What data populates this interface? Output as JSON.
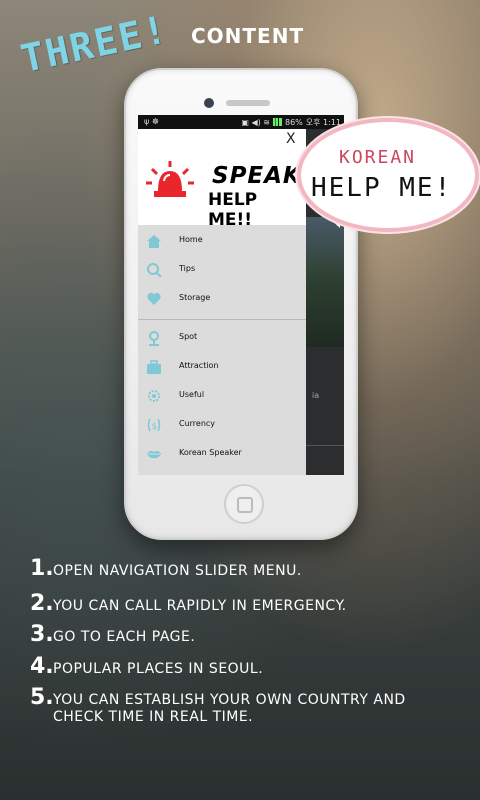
{
  "header": {
    "three": "THREE!",
    "content": "CONTENT"
  },
  "phone": {
    "statusbar": {
      "battery": "86%",
      "time": "오후 1:11"
    },
    "drawer": {
      "close": "X",
      "logo": {
        "speak": "SPEAK",
        "help": "HELP ME!!"
      },
      "items": [
        {
          "label": "Home",
          "icon": "home-icon"
        },
        {
          "label": "Tips",
          "icon": "search-icon"
        },
        {
          "label": "Storage",
          "icon": "heart-icon"
        },
        {
          "label": "Spot",
          "icon": "map-pin-icon"
        },
        {
          "label": "Attraction",
          "icon": "briefcase-icon"
        },
        {
          "label": "Useful",
          "icon": "gear-icon"
        },
        {
          "label": "Currency",
          "icon": "currency-icon"
        },
        {
          "label": "Korean Speaker",
          "icon": "lips-icon"
        }
      ]
    },
    "behind_text": "ia"
  },
  "bubble": {
    "korean": "KOREAN",
    "help": "HELP ME!"
  },
  "steps": [
    {
      "num": "1.",
      "text": "OPEN NAVIGATION SLIDER MENU."
    },
    {
      "num": "2.",
      "text": "YOU CAN CALL RAPIDLY IN EMERGENCY."
    },
    {
      "num": "3.",
      "text": "GO TO EACH PAGE."
    },
    {
      "num": "4.",
      "text": "POPULAR PLACES IN SEOUL."
    },
    {
      "num": "5.",
      "text": "YOU CAN ESTABLISH YOUR OWN COUNTRY AND CHECK TIME IN REAL TIME."
    }
  ],
  "colors": {
    "accent": "#7fd4e6",
    "icon": "#7fc9d6",
    "siren": "#e8262b",
    "bubble_border": "#f3b7c2"
  }
}
